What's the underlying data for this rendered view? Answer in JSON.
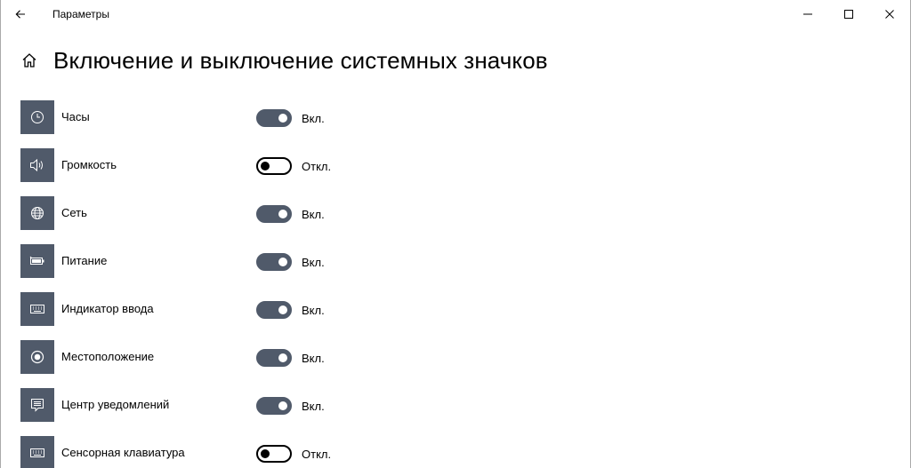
{
  "window": {
    "title": "Параметры",
    "controls": {
      "minimize_icon": "minimize-icon",
      "maximize_icon": "maximize-icon",
      "close_icon": "close-icon"
    }
  },
  "header": {
    "title": "Включение и выключение системных значков",
    "home_icon": "home-icon"
  },
  "colors": {
    "accent": "#505a6a",
    "toggle_off_border": "#000000"
  },
  "items": [
    {
      "label": "Часы",
      "icon": "clock-icon",
      "state": "on",
      "state_label": "Вкл."
    },
    {
      "label": "Громкость",
      "icon": "speaker-icon",
      "state": "off",
      "state_label": "Откл."
    },
    {
      "label": "Сеть",
      "icon": "globe-icon",
      "state": "on",
      "state_label": "Вкл."
    },
    {
      "label": "Питание",
      "icon": "battery-icon",
      "state": "on",
      "state_label": "Вкл."
    },
    {
      "label": "Индикатор ввода",
      "icon": "keyboard-icon",
      "state": "on",
      "state_label": "Вкл."
    },
    {
      "label": "Местоположение",
      "icon": "location-icon",
      "state": "on",
      "state_label": "Вкл."
    },
    {
      "label": "Центр уведомлений",
      "icon": "notification-icon",
      "state": "on",
      "state_label": "Вкл."
    },
    {
      "label": "Сенсорная клавиатура",
      "icon": "touch-keyboard-icon",
      "state": "off",
      "state_label": "Откл."
    }
  ]
}
